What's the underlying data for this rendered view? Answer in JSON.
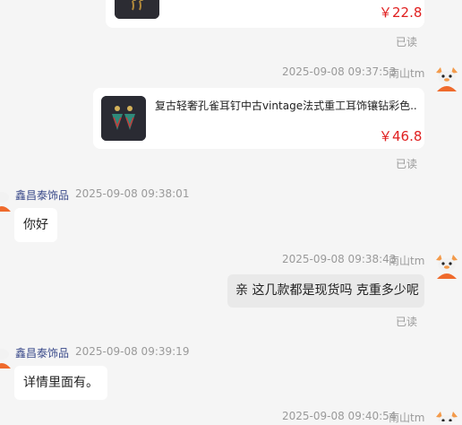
{
  "messages": {
    "card1": {
      "price": "￥22.8",
      "read": "已读"
    },
    "msg2": {
      "time": "2025-09-08 09:37:53",
      "sender": "南山tm",
      "title": "复古轻奢孔雀耳钉中古vintage法式重工耳饰镶钻彩色...",
      "price": "￥46.8",
      "read": "已读"
    },
    "msg3": {
      "sender": "鑫昌泰饰品",
      "time": "2025-09-08 09:38:01",
      "text": "你好"
    },
    "msg4": {
      "time": "2025-09-08 09:38:43",
      "sender": "南山tm",
      "text": "亲 这几款都是现货吗 克重多少呢",
      "read": "已读"
    },
    "msg5": {
      "sender": "鑫昌泰饰品",
      "time": "2025-09-08 09:39:19",
      "text": "详情里面有。"
    },
    "msg6": {
      "time": "2025-09-08 09:40:54",
      "sender": "南山tm"
    }
  },
  "colors": {
    "price": "#e02020",
    "seller_name": "#3a4a8a",
    "background": "#f5f5f5"
  },
  "icons": {
    "user_avatar": "cartoon-avatar-icon",
    "seller_avatar": "cartoon-avatar-icon"
  }
}
